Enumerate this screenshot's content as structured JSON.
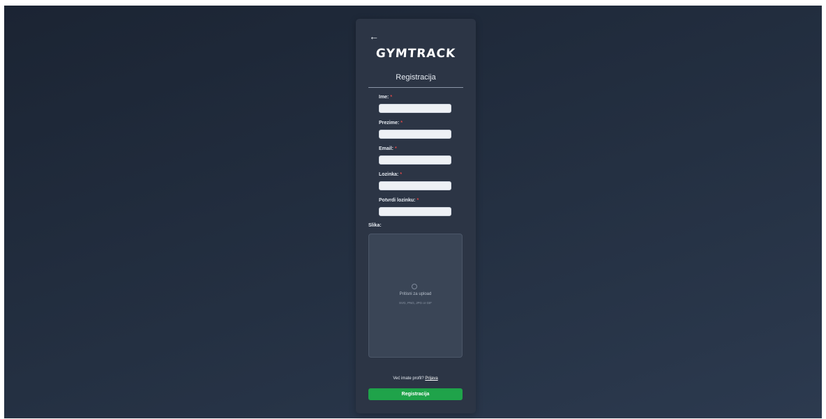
{
  "app": {
    "logo": "GYMTRACK"
  },
  "form": {
    "title": "Registracija",
    "required_marker": "*",
    "fields": [
      {
        "label": "Ime:",
        "value": "",
        "placeholder": ""
      },
      {
        "label": "Prezime:",
        "value": "",
        "placeholder": ""
      },
      {
        "label": "Email:",
        "value": "",
        "placeholder": ""
      },
      {
        "label": "Lozinka:",
        "value": "",
        "placeholder": ""
      },
      {
        "label": "Potvrdi lozinku:",
        "value": "",
        "placeholder": ""
      }
    ],
    "image_label": "Slika:",
    "upload": {
      "text": "Pritisni za upload",
      "hint": "SVG, PNG, JPG or GIF"
    },
    "login_prompt": "Već imate profil?",
    "login_link": "Prijava",
    "submit_label": "Registracija"
  },
  "colors": {
    "background": "#1b2433",
    "card": "#2c3545",
    "accent": "#1fa34a",
    "required": "#e04848"
  },
  "icons": {
    "back": "arrow-left-icon",
    "upload": "upload-icon"
  }
}
